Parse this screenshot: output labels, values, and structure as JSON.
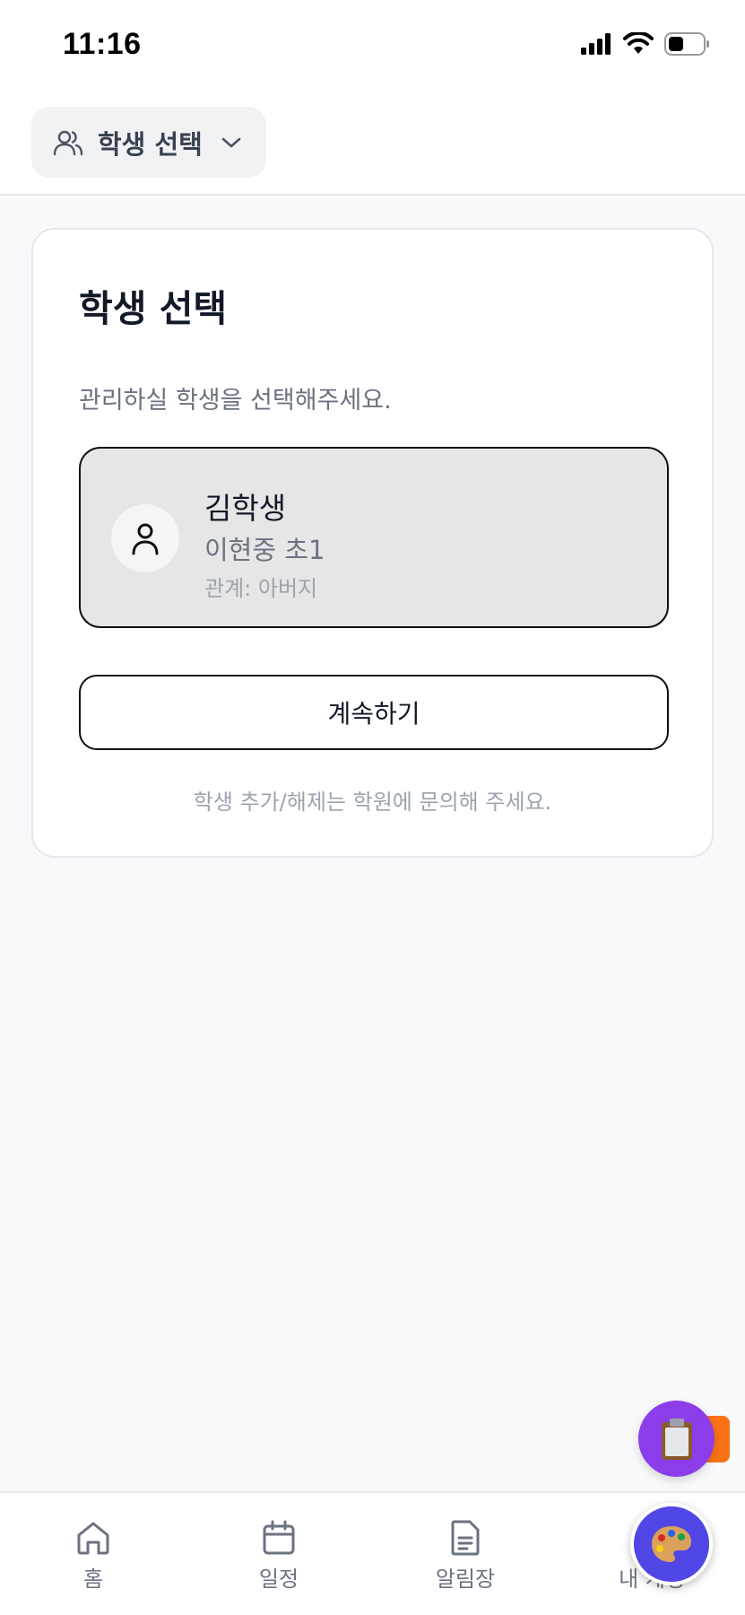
{
  "status_bar": {
    "time": "11:16",
    "icons": [
      "signal-icon",
      "wifi-icon",
      "battery-icon"
    ]
  },
  "header": {
    "selector_label": "학생 선택",
    "selector_icon": "users-icon",
    "chevron_icon": "chevron-down-icon"
  },
  "card": {
    "title": "학생 선택",
    "description": "관리하실 학생을 선택해주세요.",
    "students": [
      {
        "name": "김학생",
        "school": "이현중 초1",
        "relation": "관계: 아버지",
        "icon": "user-icon",
        "selected": true
      }
    ],
    "continue_label": "계속하기",
    "note": "학생 추가/해제는 학원에 문의해 주세요."
  },
  "floating_buttons": {
    "clipboard_icon": "clipboard-icon",
    "palette_icon": "palette-icon",
    "clipboard_color": "#8b3dea",
    "palette_color": "#4f46e5",
    "tab_color": "#f97316"
  },
  "bottom_nav": {
    "items": [
      {
        "label": "홈",
        "icon": "home-icon"
      },
      {
        "label": "일정",
        "icon": "calendar-icon"
      },
      {
        "label": "알림장",
        "icon": "document-icon"
      },
      {
        "label": "내 계정",
        "icon": "account-icon"
      }
    ]
  }
}
